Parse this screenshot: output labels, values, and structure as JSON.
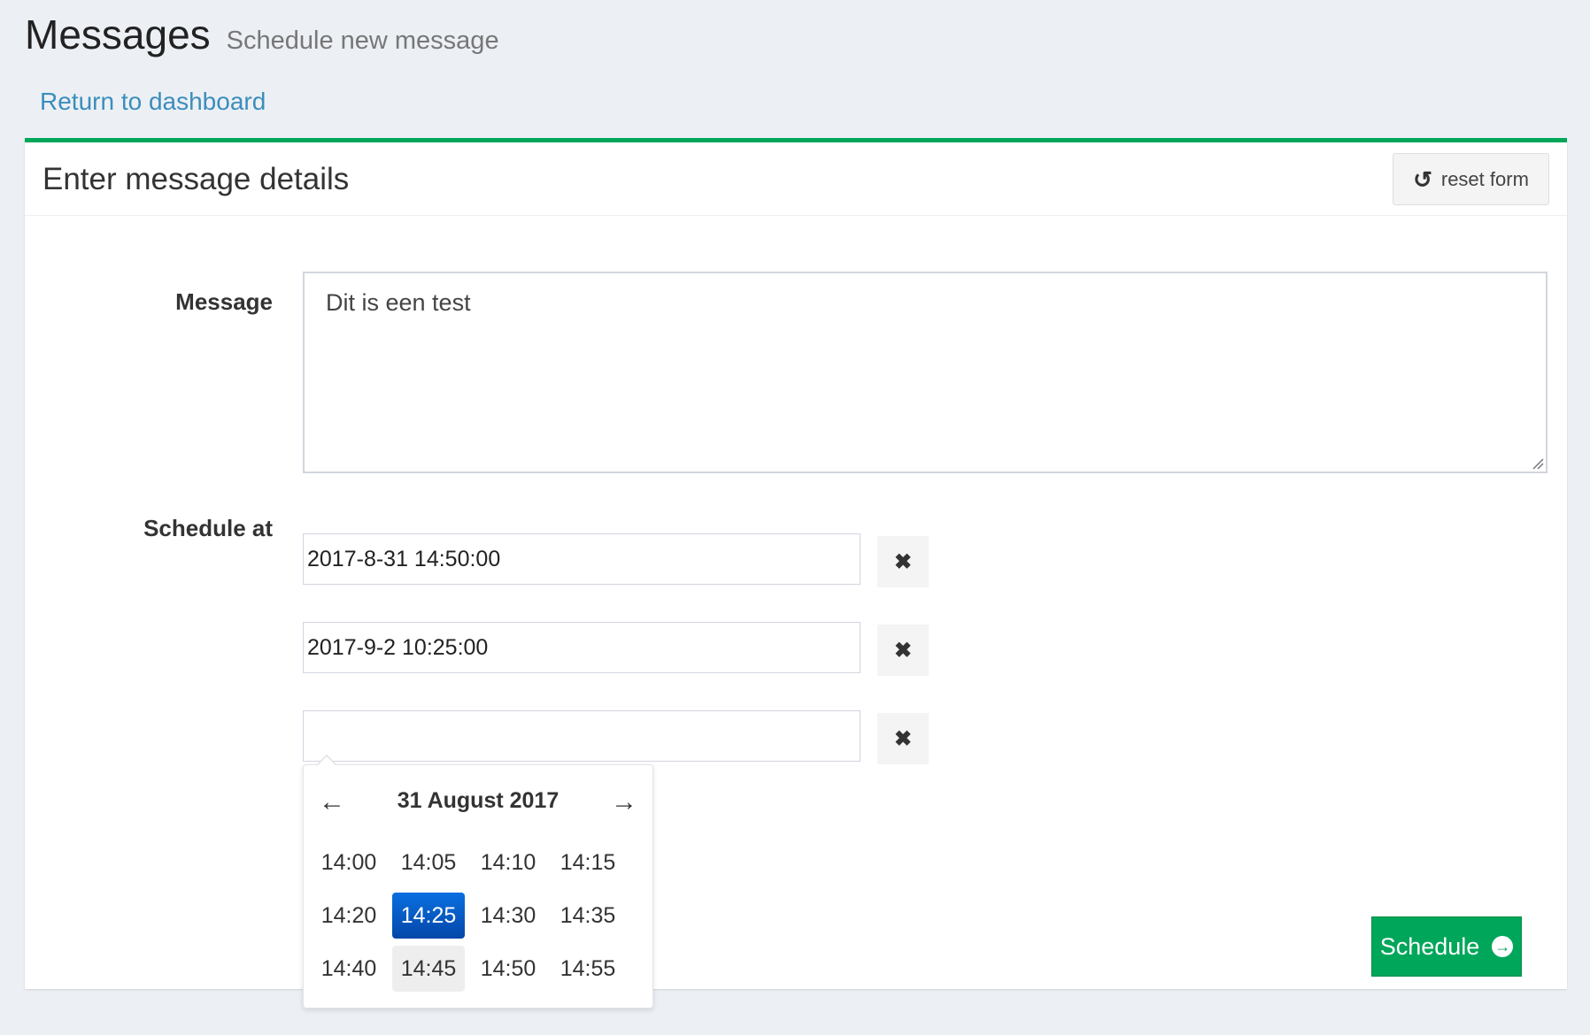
{
  "header": {
    "title": "Messages",
    "subtitle": "Schedule new message",
    "back_link": "Return to dashboard"
  },
  "box": {
    "title": "Enter message details",
    "reset_label": "reset form",
    "accent_color": "#00a65a"
  },
  "form": {
    "message_label": "Message",
    "message_value": "Dit is een test",
    "schedule_label": "Schedule at",
    "schedule_values": [
      "2017-8-31 14:50:00",
      "2017-9-2 10:25:00",
      ""
    ],
    "remove_icon": "times-icon",
    "submit_label": "Schedule"
  },
  "picker": {
    "title": "31 August 2017",
    "prev_icon": "arrow-left-icon",
    "next_icon": "arrow-right-icon",
    "times": [
      "14:00",
      "14:05",
      "14:10",
      "14:15",
      "14:20",
      "14:25",
      "14:30",
      "14:35",
      "14:40",
      "14:45",
      "14:50",
      "14:55"
    ],
    "selected": "14:25",
    "hovered": "14:45",
    "selected_color": "#0a5fcc"
  }
}
